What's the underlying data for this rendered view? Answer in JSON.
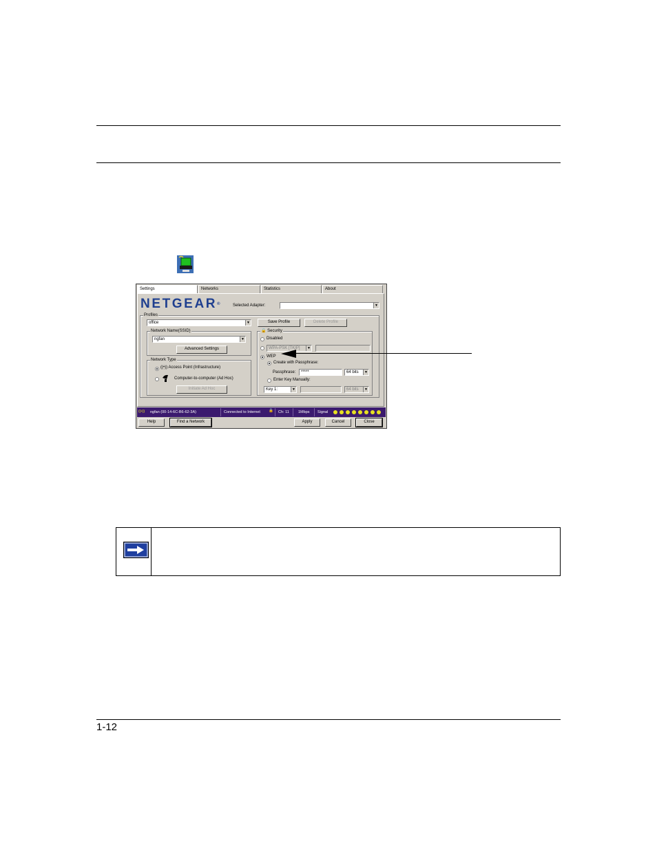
{
  "page": {
    "number": "1-12"
  },
  "dialog": {
    "tabs": [
      {
        "label": "Settings"
      },
      {
        "label": "Networks"
      },
      {
        "label": "Statistics"
      },
      {
        "label": "About"
      }
    ],
    "logo_text": "NETGEAR",
    "selected_adapter_label": "Selected Adapter:",
    "profiles": {
      "group_title": "Profiles",
      "value": "office",
      "save_button": "Save Profile",
      "delete_button": "Delete Profile"
    },
    "network_name": {
      "group_title": "Network Name(SSID)",
      "value": "ngfan",
      "advanced_button": "Advanced Settings"
    },
    "network_type": {
      "group_title": "Network Type",
      "access_point": "Access Point (Infrastructure)",
      "ad_hoc": "Computer-to-computer (Ad Hoc)",
      "initiate_button": "Initiate Ad Hoc"
    },
    "security": {
      "group_title": "Security",
      "disabled": "Disabled",
      "wpa": "WPA-PSK [TKIP]",
      "wep": "WEP",
      "create_passphrase": "Create with Passphrase:",
      "passphrase_label": "Passphrase:",
      "passphrase_value": "*****",
      "bits_value": "64 bits",
      "enter_manually": "Enter Key Manually:",
      "key_value": "Key 1:",
      "key_bits": "64 bits"
    },
    "status": {
      "network": "ngfan (00-14-6C-B6-62-3A)",
      "connection": "Connected to Internet",
      "channel": "Ch: 11",
      "rate": "1Mbps",
      "signal_label": "Signal",
      "signal_dots": 8
    },
    "buttons": {
      "help": "Help",
      "find": "Find a Network",
      "apply": "Apply",
      "cancel": "Cancel",
      "close": "Close"
    }
  },
  "colors": {
    "logo": "#1f3f8f",
    "status_bar": "#3b1a6e",
    "note_arrow": "#1f3f9f"
  }
}
